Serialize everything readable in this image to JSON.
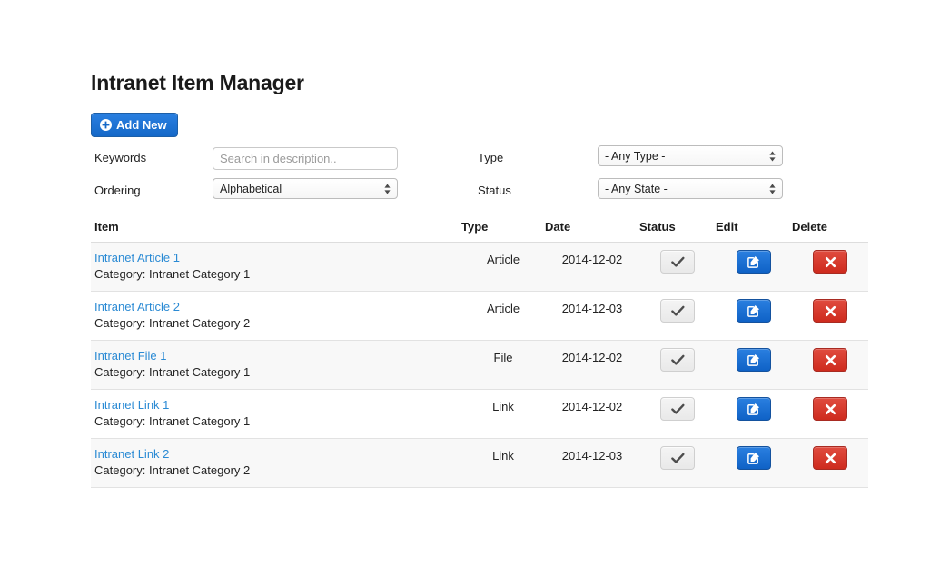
{
  "page": {
    "title": "Intranet Item Manager"
  },
  "toolbar": {
    "add_new_label": "Add New",
    "add_new_icon": "plus-circle-icon",
    "accent_blue": "#1568c8"
  },
  "filters": {
    "keywords": {
      "label": "Keywords",
      "placeholder": "Search in description..",
      "value": ""
    },
    "ordering": {
      "label": "Ordering",
      "value": "Alphabetical",
      "options": [
        "Alphabetical"
      ]
    },
    "type": {
      "label": "Type",
      "value": "- Any Type -",
      "options": [
        "- Any Type -"
      ]
    },
    "status": {
      "label": "Status",
      "value": "- Any State -",
      "options": [
        "- Any State -"
      ]
    }
  },
  "table": {
    "columns": {
      "item": "Item",
      "type": "Type",
      "date": "Date",
      "status": "Status",
      "edit": "Edit",
      "delete": "Delete"
    },
    "icons": {
      "status": "check-icon",
      "edit": "pencil-square-icon",
      "delete": "x-icon"
    },
    "colors": {
      "link": "#2a8ad4",
      "edit_button": "#0f62c6",
      "delete_button": "#ce2b1e",
      "status_button": "#e9e9e9",
      "row_stripe": "#f8f8f8"
    },
    "rows": [
      {
        "name": "Intranet Article 1",
        "category": "Category: Intranet Category 1",
        "type": "Article",
        "date": "2014-12-02"
      },
      {
        "name": "Intranet Article 2",
        "category": "Category: Intranet Category 2",
        "type": "Article",
        "date": "2014-12-03"
      },
      {
        "name": "Intranet File 1",
        "category": "Category: Intranet Category 1",
        "type": "File",
        "date": "2014-12-02"
      },
      {
        "name": "Intranet Link 1",
        "category": "Category: Intranet Category 1",
        "type": "Link",
        "date": "2014-12-02"
      },
      {
        "name": "Intranet Link 2",
        "category": "Category: Intranet Category 2",
        "type": "Link",
        "date": "2014-12-03"
      }
    ]
  }
}
